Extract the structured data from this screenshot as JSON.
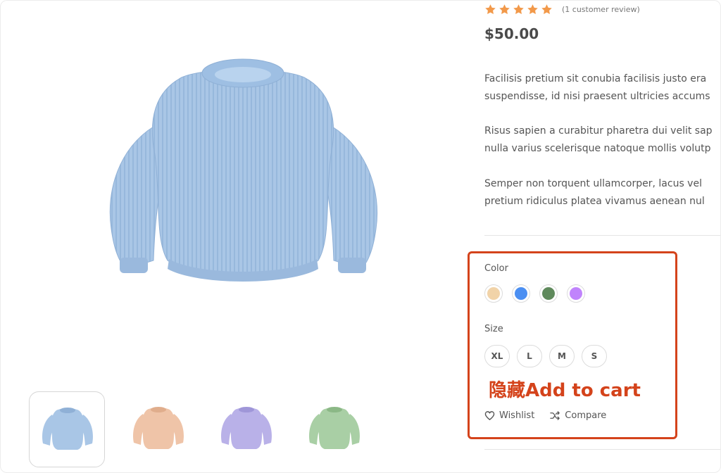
{
  "product": {
    "rating_stars": 5,
    "review_count": "(1 customer review)",
    "price": "$50.00",
    "description": [
      [
        "Facilisis pretium sit conubia facilisis justo era",
        "suspendisse, id nisi praesent ultricies accums"
      ],
      [
        "Risus sapien a curabitur pharetra dui velit sap",
        "nulla varius scelerisque natoque mollis volutp"
      ],
      [
        "Semper non torquent ullamcorper, lacus vel",
        "pretium ridiculus platea vivamus aenean nul"
      ]
    ]
  },
  "colors": {
    "brand_accent": "#d4431b",
    "star": "#f2994a",
    "main_sweater": "#a9c6e6",
    "thumbnails": [
      "#a9c6e6",
      "#efc4a8",
      "#b9b1e8",
      "#a9cfa5"
    ]
  },
  "options": {
    "color_label": "Color",
    "color_swatches": [
      "#f1d3a8",
      "#4b8ff2",
      "#5f8a5c",
      "#c084fc"
    ],
    "size_label": "Size",
    "sizes": [
      "XL",
      "L",
      "M",
      "S"
    ]
  },
  "annotation": "隐藏Add to cart",
  "actions": {
    "wishlist": "Wishlist",
    "compare": "Compare"
  },
  "icons": {
    "star": "star-icon",
    "wishlist": "heart-icon",
    "compare": "shuffle-icon"
  }
}
